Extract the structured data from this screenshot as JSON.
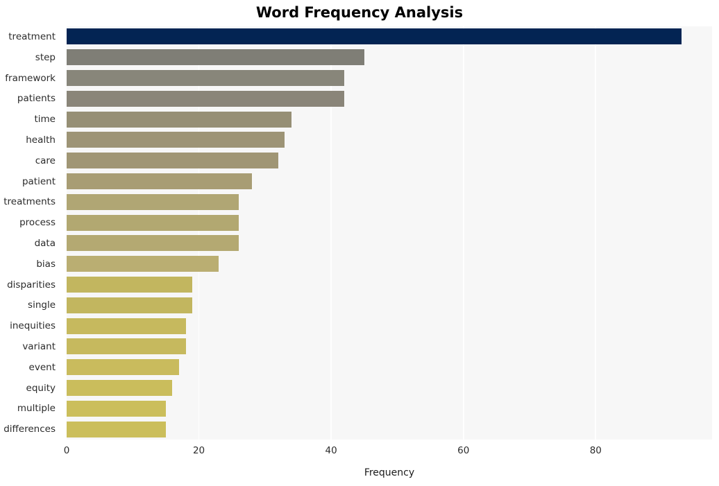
{
  "chart_data": {
    "type": "bar",
    "orientation": "horizontal",
    "title": "Word Frequency Analysis",
    "xlabel": "Frequency",
    "ylabel": "",
    "xlim": [
      0,
      97.6
    ],
    "ylim": null,
    "grid": true,
    "legend": null,
    "xticks": [
      0,
      20,
      40,
      60,
      80
    ],
    "xtick_labels": [
      "0",
      "20",
      "40",
      "60",
      "80"
    ],
    "categories": [
      "treatment",
      "step",
      "framework",
      "patients",
      "time",
      "health",
      "care",
      "patient",
      "treatments",
      "process",
      "data",
      "bias",
      "disparities",
      "single",
      "inequities",
      "variant",
      "event",
      "equity",
      "multiple",
      "differences"
    ],
    "values": [
      93,
      45,
      42,
      42,
      34,
      33,
      32,
      28,
      26,
      26,
      26,
      23,
      19,
      19,
      18,
      18,
      17,
      16,
      15,
      15
    ],
    "bar_colors": [
      "#032453",
      "#7f7e76",
      "#88867a",
      "#8a8579",
      "#968f75",
      "#9d9476",
      "#a09675",
      "#a89d74",
      "#b0a674",
      "#b2a871",
      "#b4a972",
      "#baae72",
      "#c2b65f",
      "#c2b65f",
      "#c6b95e",
      "#c6b95e",
      "#c9bb5d",
      "#cabd5c",
      "#cbbe5b",
      "#cbbe5b"
    ],
    "plot_background": "#f7f7f7",
    "page_background": "#ffffff",
    "gridline_color": "#ffffff"
  }
}
